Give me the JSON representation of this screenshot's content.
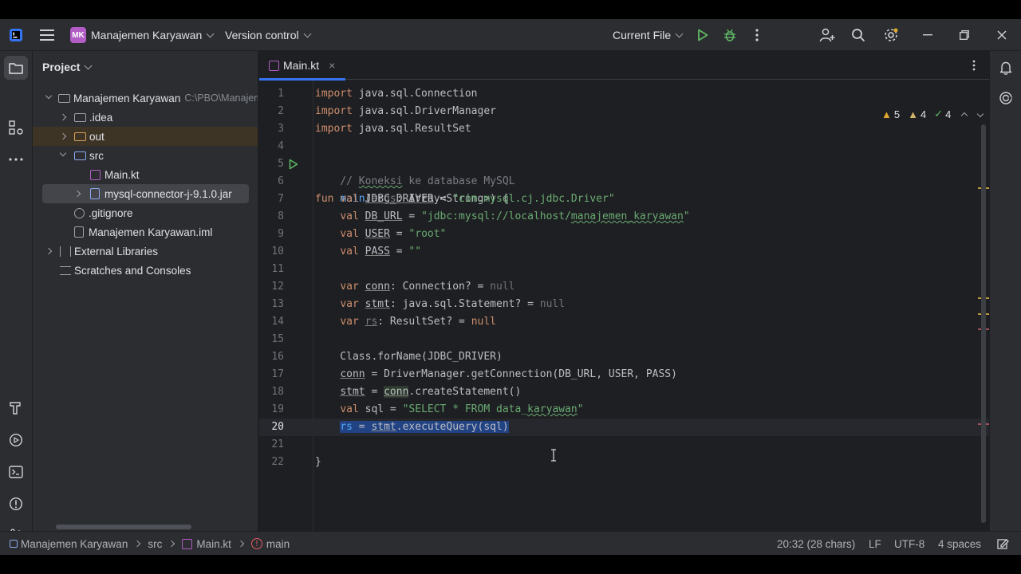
{
  "titlebar": {
    "project_badge": "MK",
    "project_name": "Manajemen Karyawan",
    "vcs": "Version control",
    "run_config": "Current File"
  },
  "project_panel": {
    "title": "Project",
    "items": [
      {
        "label": "Manajemen Karyawan",
        "extra": "C:\\PBO\\Manajemen Karyawan"
      },
      {
        "label": ".idea"
      },
      {
        "label": "out"
      },
      {
        "label": "src"
      },
      {
        "label": "Main.kt"
      },
      {
        "label": "mysql-connector-j-9.1.0.jar"
      },
      {
        "label": ".gitignore"
      },
      {
        "label": "Manajemen Karyawan.iml"
      },
      {
        "label": "External Libraries"
      },
      {
        "label": "Scratches and Consoles"
      }
    ]
  },
  "editor": {
    "tab": "Main.kt",
    "inspections": {
      "warnings": "5",
      "weak_warnings": "4",
      "typos": "4"
    },
    "line_numbers": [
      "1",
      "2",
      "3",
      "4",
      "5",
      "6",
      "7",
      "8",
      "9",
      "10",
      "11",
      "12",
      "13",
      "14",
      "15",
      "16",
      "17",
      "18",
      "19",
      "20",
      "21",
      "22"
    ]
  },
  "statusbar": {
    "breadcrumb": [
      "Manajemen Karyawan",
      "src",
      "Main.kt",
      "main"
    ],
    "position": "20:32 (28 chars)",
    "line_ending": "LF",
    "encoding": "UTF-8",
    "indent": "4 spaces"
  },
  "colors": {
    "accent": "#3574f0",
    "background": "#1e1f22",
    "panel": "#2b2d30",
    "badge": "#b25dc6",
    "run": "#5fb865",
    "warning": "#e0a82e"
  }
}
